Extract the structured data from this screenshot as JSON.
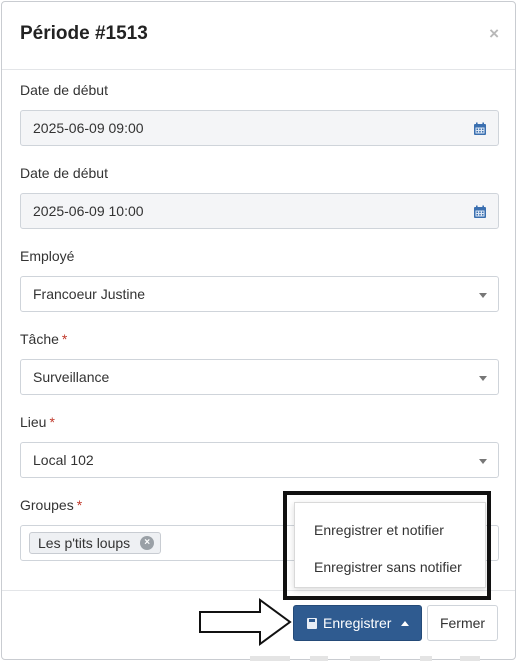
{
  "modal": {
    "title": "Période #1513",
    "close_glyph": "×"
  },
  "fields": {
    "start_date": {
      "label": "Date de début",
      "value": "2025-06-09 09:00",
      "icon": "calendar-icon"
    },
    "end_date": {
      "label": "Date de début",
      "value": "2025-06-09 10:00",
      "icon": "calendar-icon"
    },
    "employee": {
      "label": "Employé",
      "value": "Francoeur Justine"
    },
    "task": {
      "label": "Tâche",
      "required_mark": "*",
      "value": "Surveillance"
    },
    "location": {
      "label": "Lieu",
      "required_mark": "*",
      "value": "Local 102"
    },
    "groups": {
      "label": "Groupes",
      "required_mark": "*",
      "tags": [
        "Les p'tits loups"
      ]
    }
  },
  "dropdown": {
    "items": [
      "Enregistrer et notifier",
      "Enregistrer sans notifier"
    ]
  },
  "footer": {
    "save_label": "Enregistrer",
    "close_label": "Fermer"
  },
  "colors": {
    "primary": "#2f5b90",
    "required": "#c0392b",
    "calendar": "#3a6fb0",
    "annotation": "#111111"
  }
}
